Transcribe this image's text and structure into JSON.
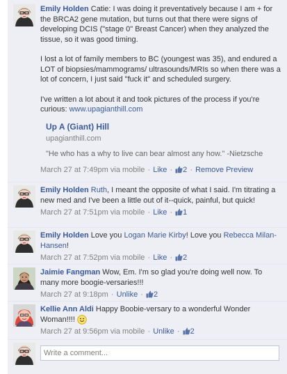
{
  "comments": [
    {
      "author": "Emily Holden",
      "paragraphs": [
        "Catie: I was doing it preventatively because I am + for the BRCA2 gene mutation, but turns out that there were signs of developing DCIS (\"stage 0\" Breast Cancer) when they analyzed the tissue, so it was good timing.",
        "I lost a lot of family members to BC (youngest was 35), and endured a LOT of biopsies/mammograms/ ultrasounds/MRIs so when there was a lot of concern, I just said \"fuck it\" and scheduled surgery.",
        "I've written a lot about it and took pictures of the process if you're curious: "
      ],
      "link": "www.upagianthill.com",
      "preview": {
        "title": "Up A (Giant) Hill",
        "domain": "upagianthill.com",
        "description": "\"He who has a why to live can bear almost any how.\" -Nietzsche"
      },
      "time": "March 27 at 7:49pm via mobile",
      "like_label": "Like",
      "like_count": "2",
      "extra_action": "Remove Preview"
    },
    {
      "author": "Emily Holden",
      "mention": "Ruth",
      "text": ", I meant the opposite of what I said. I'm titrating a new med and I've been a little out of it--quick, painful, but quick!",
      "time": "March 27 at 7:51pm via mobile",
      "like_label": "Like",
      "like_count": "1"
    },
    {
      "author": "Emily Holden",
      "text_before": "Love you ",
      "mention1": "Logan Marie Kirby",
      "text_middle": "! Love you ",
      "mention2": "Rebecca Milan-Hansen",
      "text_after": "!",
      "time": "March 27 at 7:52pm via mobile",
      "like_label": "Like",
      "like_count": "2"
    },
    {
      "author": "Jaimie Fangman",
      "text": "Wow, Em. I'm so glad you're doing well now. To many more boogie-versaries!!!",
      "time": "March 27 at 9:18pm",
      "like_label": "Unlike",
      "like_count": "2"
    },
    {
      "author": "Kellie Ann Aldi",
      "text": "Happy Boobie-versary to a wonderful Wonder Woman!!!! ",
      "time": "March 27 at 9:56pm",
      "via": "via mobile",
      "like_label": "Unlike",
      "like_count": "2"
    }
  ],
  "composer": {
    "placeholder": "Write a comment..."
  },
  "colors": {
    "link": "#3b5998",
    "thread_bg": "#edeff4",
    "meta": "#808080"
  }
}
